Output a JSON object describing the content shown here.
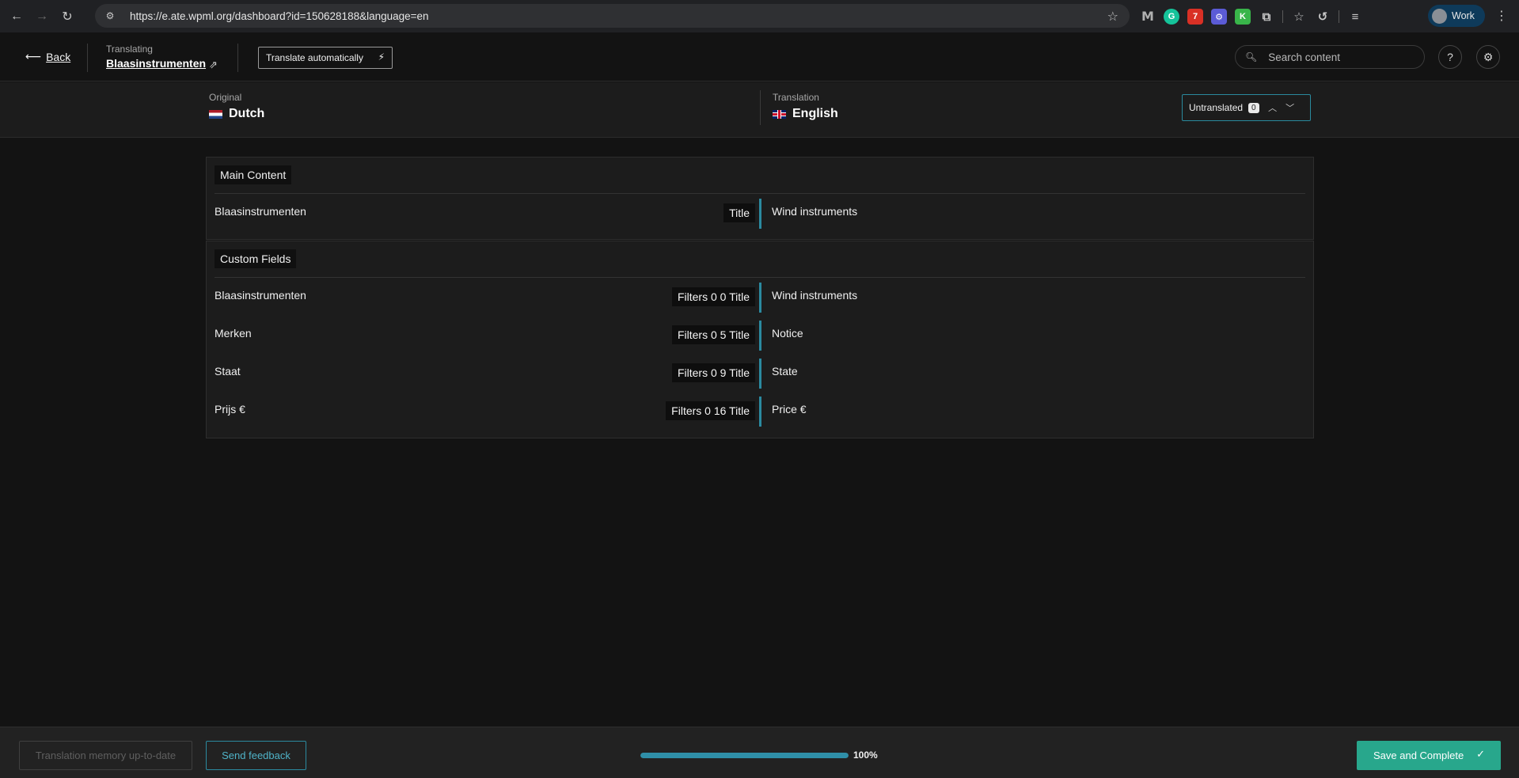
{
  "browser": {
    "url": "https://e.ate.wpml.org/dashboard?id=150628188&language=en",
    "calendar_badge": "7",
    "k_ext": "K",
    "profile_name": "Work"
  },
  "header": {
    "back_label": "Back",
    "translating_label": "Translating",
    "document_title": "Blaasinstrumenten",
    "translate_auto_label": "Translate automatically",
    "search_placeholder": "Search content"
  },
  "languages": {
    "original_caption": "Original",
    "original_lang": "Dutch",
    "translation_caption": "Translation",
    "translation_lang": "English",
    "untranslated_label": "Untranslated",
    "untranslated_count": "0"
  },
  "sections": [
    {
      "title": "Main Content",
      "rows": [
        {
          "source": "Blaasinstrumenten",
          "field": "Title",
          "target": "Wind instruments"
        }
      ]
    },
    {
      "title": "Custom Fields",
      "rows": [
        {
          "source": "Blaasinstrumenten",
          "field": "Filters 0 0 Title",
          "target": "Wind instruments"
        },
        {
          "source": "Merken",
          "field": "Filters 0 5 Title",
          "target": "Notice"
        },
        {
          "source": "Staat",
          "field": "Filters 0 9 Title",
          "target": "State"
        },
        {
          "source": "Prijs €",
          "field": "Filters 0 16 Title",
          "target": "Price €"
        }
      ]
    }
  ],
  "footer": {
    "tm_label": "Translation memory up-to-date",
    "feedback_label": "Send feedback",
    "progress_value": 100,
    "progress_text": "100%",
    "save_label": "Save and Complete"
  },
  "colors": {
    "accent": "#2b8aa0",
    "save": "#28a78c"
  }
}
